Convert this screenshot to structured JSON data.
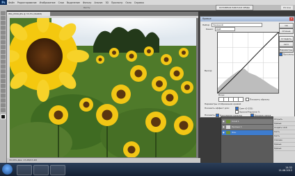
{
  "menubar": {
    "app_badge": "Ps",
    "items": [
      "Файл",
      "Редактирование",
      "Изображение",
      "Слои",
      "Выделение",
      "Фильтр",
      "Анализ",
      "3D",
      "Просмотр",
      "Окно",
      "Справка"
    ]
  },
  "options_bar": {
    "essentials": "ОСНОВНАЯ РАБОЧАЯ СРЕДА",
    "cs_live": "CS Live",
    "hint": "Кисть: "
  },
  "document": {
    "tab_title": "IMG_6599.JPG @ 33,3% (RGB/8)",
    "status": "33,33%  Док: 17,2M/17,2M"
  },
  "dialog": {
    "title": "Кривые",
    "preset_label": "Набор:",
    "preset_value": "Заказной",
    "channel_label": "Канал:",
    "channel_value": "RGB",
    "output_label": "Выход:",
    "input_label": "Вход:",
    "show_clipping": "Показать обрезку",
    "display_options": "Параметры отображения кривой",
    "show_amount_label": "Показать эффект для:",
    "light": "Свет (0-255)",
    "pigment": "Краска/Чернила %",
    "show_label": "Показать:",
    "channel_overlays": "Наложения каналов",
    "baseline": "Базовая линия",
    "histogram": "Гистограмма",
    "intersection": "Линия пересечения",
    "ok": "OK",
    "cancel": "Отмена",
    "smooth": "Сгладить",
    "auto": "Авто",
    "options": "Параметры...",
    "preview": "Просмотр"
  },
  "layers": [
    {
      "name": "Слой 1"
    },
    {
      "name": "Кривые 1"
    },
    {
      "name": "Фон"
    }
  ],
  "history": [
    "Открыть",
    "Кривые",
    "Создать слой",
    "Кисть",
    "Кисть",
    "Слияние",
    "Кривые",
    "Кривые"
  ],
  "taskbar": {
    "time": "14:32",
    "date": "21.08.2012"
  },
  "colors": {
    "accent": "#3d7ccf",
    "ps_blue": "#0a2b5a"
  }
}
